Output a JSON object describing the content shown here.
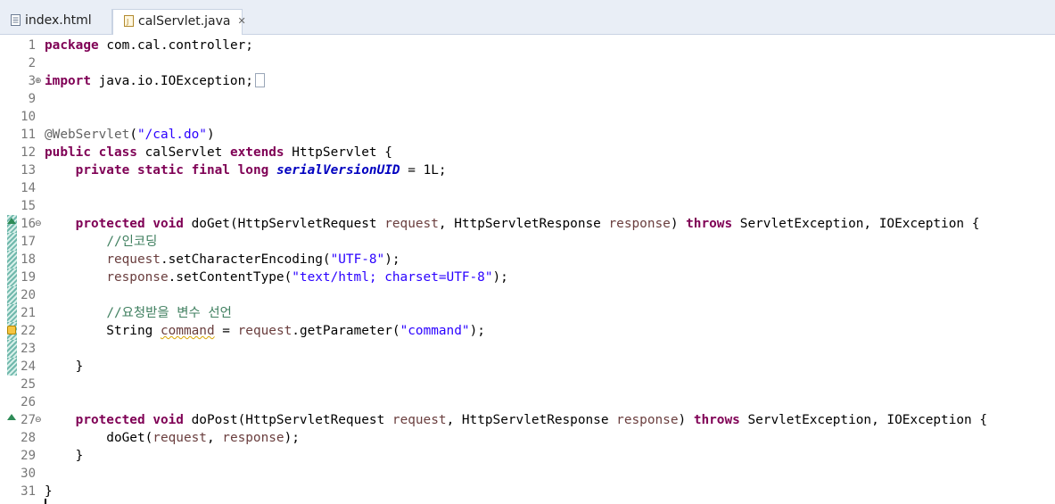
{
  "tabs": [
    {
      "label": "index.html",
      "icon": "html-file-icon",
      "active": false
    },
    {
      "label": "calServlet.java",
      "icon": "java-file-icon",
      "active": true,
      "close": "✕"
    }
  ],
  "lines": [
    {
      "n": "1",
      "tokens": [
        {
          "t": "package",
          "c": "k"
        },
        {
          "t": " com.cal.controller;"
        }
      ]
    },
    {
      "n": "2",
      "tokens": []
    },
    {
      "n": "3",
      "fold": "plus",
      "tokens": [
        {
          "t": "import",
          "c": "k"
        },
        {
          "t": " java.io.IOException;"
        }
      ],
      "folded": true
    },
    {
      "n": "9",
      "tokens": []
    },
    {
      "n": "10",
      "tokens": []
    },
    {
      "n": "11",
      "tokens": [
        {
          "t": "@WebServlet",
          "c": "a"
        },
        {
          "t": "("
        },
        {
          "t": "\"/cal.do\"",
          "c": "s"
        },
        {
          "t": ")"
        }
      ]
    },
    {
      "n": "12",
      "tokens": [
        {
          "t": "public",
          "c": "k"
        },
        {
          "t": " "
        },
        {
          "t": "class",
          "c": "k"
        },
        {
          "t": " calServlet "
        },
        {
          "t": "extends",
          "c": "k"
        },
        {
          "t": " HttpServlet {"
        }
      ]
    },
    {
      "n": "13",
      "tokens": [
        {
          "t": "    "
        },
        {
          "t": "private",
          "c": "k"
        },
        {
          "t": " "
        },
        {
          "t": "static",
          "c": "k"
        },
        {
          "t": " "
        },
        {
          "t": "final",
          "c": "k"
        },
        {
          "t": " "
        },
        {
          "t": "long",
          "c": "k"
        },
        {
          "t": " "
        },
        {
          "t": "serialVersionUID",
          "c": "f"
        },
        {
          "t": " = 1L;"
        }
      ]
    },
    {
      "n": "14",
      "tokens": []
    },
    {
      "n": "15",
      "tokens": []
    },
    {
      "n": "16",
      "fold": "minus",
      "ovr": true,
      "tokens": [
        {
          "t": "    "
        },
        {
          "t": "protected",
          "c": "k"
        },
        {
          "t": " "
        },
        {
          "t": "void",
          "c": "k"
        },
        {
          "t": " doGet(HttpServletRequest "
        },
        {
          "t": "request",
          "c": "p"
        },
        {
          "t": ", HttpServletResponse "
        },
        {
          "t": "response",
          "c": "p"
        },
        {
          "t": ") "
        },
        {
          "t": "throws",
          "c": "k"
        },
        {
          "t": " ServletException, IOException {"
        }
      ]
    },
    {
      "n": "17",
      "tokens": [
        {
          "t": "        "
        },
        {
          "t": "//인코딩",
          "c": "c"
        }
      ]
    },
    {
      "n": "18",
      "tokens": [
        {
          "t": "        "
        },
        {
          "t": "request",
          "c": "p"
        },
        {
          "t": ".setCharacterEncoding("
        },
        {
          "t": "\"UTF-8\"",
          "c": "s"
        },
        {
          "t": ");"
        }
      ]
    },
    {
      "n": "19",
      "tokens": [
        {
          "t": "        "
        },
        {
          "t": "response",
          "c": "p"
        },
        {
          "t": ".setContentType("
        },
        {
          "t": "\"text/html; charset=UTF-8\"",
          "c": "s"
        },
        {
          "t": ");"
        }
      ]
    },
    {
      "n": "20",
      "tokens": []
    },
    {
      "n": "21",
      "tokens": [
        {
          "t": "        "
        },
        {
          "t": "//요청받을 변수 선언",
          "c": "c"
        }
      ]
    },
    {
      "n": "22",
      "warn": true,
      "tokens": [
        {
          "t": "        String "
        },
        {
          "t": "command",
          "c": "p warn"
        },
        {
          "t": " = "
        },
        {
          "t": "request",
          "c": "p"
        },
        {
          "t": ".getParameter("
        },
        {
          "t": "\"command\"",
          "c": "s"
        },
        {
          "t": ");"
        }
      ]
    },
    {
      "n": "23",
      "tokens": []
    },
    {
      "n": "24",
      "tokens": [
        {
          "t": "    }"
        }
      ]
    },
    {
      "n": "25",
      "tokens": []
    },
    {
      "n": "26",
      "tokens": []
    },
    {
      "n": "27",
      "fold": "minus",
      "ovr": true,
      "tokens": [
        {
          "t": "    "
        },
        {
          "t": "protected",
          "c": "k"
        },
        {
          "t": " "
        },
        {
          "t": "void",
          "c": "k"
        },
        {
          "t": " doPost(HttpServletRequest "
        },
        {
          "t": "request",
          "c": "p"
        },
        {
          "t": ", HttpServletResponse "
        },
        {
          "t": "response",
          "c": "p"
        },
        {
          "t": ") "
        },
        {
          "t": "throws",
          "c": "k"
        },
        {
          "t": " ServletException, IOException {"
        }
      ]
    },
    {
      "n": "28",
      "tokens": [
        {
          "t": "        doGet("
        },
        {
          "t": "request",
          "c": "p"
        },
        {
          "t": ", "
        },
        {
          "t": "response",
          "c": "p"
        },
        {
          "t": ");"
        }
      ]
    },
    {
      "n": "29",
      "tokens": [
        {
          "t": "    }"
        }
      ]
    },
    {
      "n": "30",
      "tokens": []
    },
    {
      "n": "31",
      "tokens": [
        {
          "t": "}"
        }
      ]
    }
  ],
  "changed_lines": [
    "16",
    "17",
    "18",
    "19",
    "20",
    "21",
    "22",
    "23",
    "24"
  ]
}
